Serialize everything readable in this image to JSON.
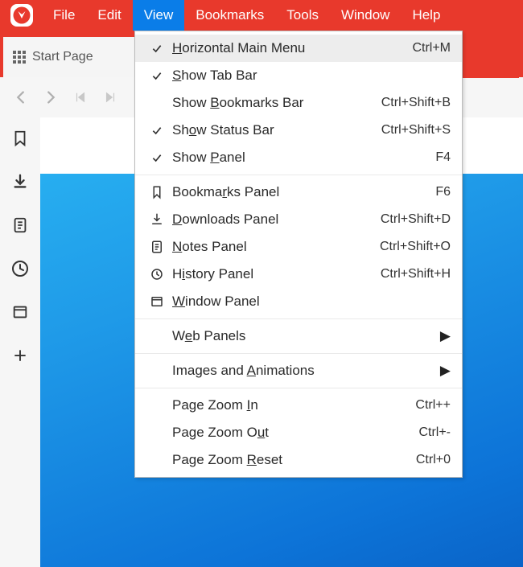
{
  "menubar": {
    "items": {
      "file": "File",
      "edit": "Edit",
      "view": "View",
      "bookmarks": "Bookmarks",
      "tools": "Tools",
      "window": "Window",
      "help": "Help"
    },
    "active": "view"
  },
  "tabs": {
    "start_page": "Start Page"
  },
  "view_menu": {
    "horizontal_main_menu": {
      "label_pre": "",
      "label_u": "H",
      "label_post": "orizontal Main Menu",
      "shortcut": "Ctrl+M",
      "checked": true
    },
    "show_tab_bar": {
      "label_pre": "",
      "label_u": "S",
      "label_post": "how Tab Bar",
      "shortcut": "",
      "checked": true
    },
    "show_bookmarks_bar": {
      "label_pre": "Show ",
      "label_u": "B",
      "label_post": "ookmarks Bar",
      "shortcut": "Ctrl+Shift+B",
      "checked": false
    },
    "show_status_bar": {
      "label_pre": "Sh",
      "label_u": "o",
      "label_post": "w Status Bar",
      "shortcut": "Ctrl+Shift+S",
      "checked": true
    },
    "show_panel": {
      "label_pre": "Show ",
      "label_u": "P",
      "label_post": "anel",
      "shortcut": "F4",
      "checked": true
    },
    "bookmarks_panel": {
      "label_pre": "Bookma",
      "label_u": "r",
      "label_post": "ks Panel",
      "shortcut": "F6"
    },
    "downloads_panel": {
      "label_pre": "",
      "label_u": "D",
      "label_post": "ownloads Panel",
      "shortcut": "Ctrl+Shift+D"
    },
    "notes_panel": {
      "label_pre": "",
      "label_u": "N",
      "label_post": "otes Panel",
      "shortcut": "Ctrl+Shift+O"
    },
    "history_panel": {
      "label_pre": "H",
      "label_u": "i",
      "label_post": "story Panel",
      "shortcut": "Ctrl+Shift+H"
    },
    "window_panel": {
      "label_pre": "",
      "label_u": "W",
      "label_post": "indow Panel",
      "shortcut": ""
    },
    "web_panels": {
      "label_pre": "W",
      "label_u": "e",
      "label_post": "b Panels"
    },
    "images_and_animations": {
      "label_pre": "Images and ",
      "label_u": "A",
      "label_post": "nimations"
    },
    "page_zoom_in": {
      "label_pre": "Page Zoom ",
      "label_u": "I",
      "label_post": "n",
      "shortcut": "Ctrl++"
    },
    "page_zoom_out": {
      "label_pre": "Page Zoom O",
      "label_u": "u",
      "label_post": "t",
      "shortcut": "Ctrl+-"
    },
    "page_zoom_reset": {
      "label_pre": "Page Zoom ",
      "label_u": "R",
      "label_post": "eset",
      "shortcut": "Ctrl+0"
    }
  }
}
